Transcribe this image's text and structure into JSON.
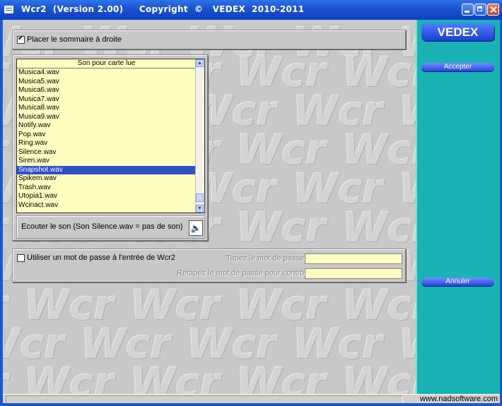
{
  "window": {
    "title": "Wcr2  (Version 2.00)     Copyright  ©   VEDEX  2010-2011",
    "buttons": [
      "minimize",
      "maximize",
      "close"
    ]
  },
  "watermark_text": "Wcr",
  "options": {
    "summary_right_label": "Placer le sommaire à droite",
    "summary_right_checked": true
  },
  "sound_list": {
    "header": "Son pour carte lue",
    "items": [
      "Musica4.wav",
      "Musica5.wav",
      "Musica6.wav",
      "Musica7.wav",
      "Musica8.wav",
      "Musica9.wav",
      "Notify.wav",
      "Pop.wav",
      "Ring.wav",
      "Silence.wav",
      "Siren.wav",
      "Snapshot.wav",
      "Spikem.wav",
      "Trash.wav",
      "Utopia1.wav",
      "Wcinact.wav"
    ],
    "selected": "Snapshot.wav",
    "listen_label": "Ecouter le son (Son Silence.wav = pas de son)"
  },
  "password": {
    "use_password_label": "Utiliser un mot de passe à l'entrée de Wcr2",
    "use_password_checked": false,
    "enter_label": "Tapez le mot de passe",
    "confirm_label": "Retapez le mot de passe pour contrôle",
    "enter_value": "",
    "confirm_value": ""
  },
  "sidebar": {
    "logo": "VEDEX",
    "accept_label": "Accepter",
    "cancel_label": "Annuler"
  },
  "status": {
    "url": "www.nadsoftware.com"
  },
  "colors": {
    "titlebar": "#1e55d0",
    "sidebar": "#19b3b3",
    "list_bg": "#ffffc0",
    "selection": "#2e4fc8",
    "client_bg": "#c8c8c8"
  }
}
